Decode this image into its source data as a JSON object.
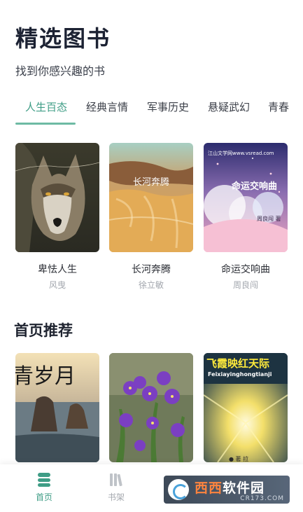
{
  "header": {
    "title": "精选图书",
    "subtitle": "找到你感兴趣的书"
  },
  "tabs": [
    {
      "label": "人生百态",
      "active": true
    },
    {
      "label": "经典言情",
      "active": false
    },
    {
      "label": "军事历史",
      "active": false
    },
    {
      "label": "悬疑武幻",
      "active": false
    },
    {
      "label": "青春",
      "active": false
    }
  ],
  "featured_books": [
    {
      "title": "卑怯人生",
      "author": "风曳",
      "cover_icon": "wolf-cover"
    },
    {
      "title": "长河奔腾",
      "author": "徐立敏",
      "cover_icon": "waterfall-cover",
      "cover_text": "长河奔腾"
    },
    {
      "title": "命运交响曲",
      "author": "周良闯",
      "cover_icon": "sky-cover",
      "cover_text": "命运交响曲",
      "cover_site": "江山文学网www.vsread.com",
      "cover_author": "周良闯 著"
    }
  ],
  "recommend": {
    "section_title": "首页推荐",
    "books": [
      {
        "cover_icon": "sea-rocks-cover",
        "cover_text": "青岁月"
      },
      {
        "cover_icon": "violets-cover"
      },
      {
        "cover_icon": "sunset-clouds-cover",
        "cover_text": "飞霞映红天际",
        "cover_pinyin": "Feixiayinghongtianji",
        "cover_author": "● 著 拉"
      }
    ]
  },
  "bottom_nav": [
    {
      "label": "首页",
      "icon": "home-icon",
      "active": true
    },
    {
      "label": "书架",
      "icon": "bookshelf-icon",
      "active": false
    }
  ],
  "watermark": {
    "brand": "西西",
    "brand2": "软件园",
    "domain": "CR173.COM"
  },
  "colors": {
    "accent": "#3f9d86",
    "indicator": "#6dbaa3",
    "title": "#1c2233",
    "muted": "#a3a7ae"
  }
}
